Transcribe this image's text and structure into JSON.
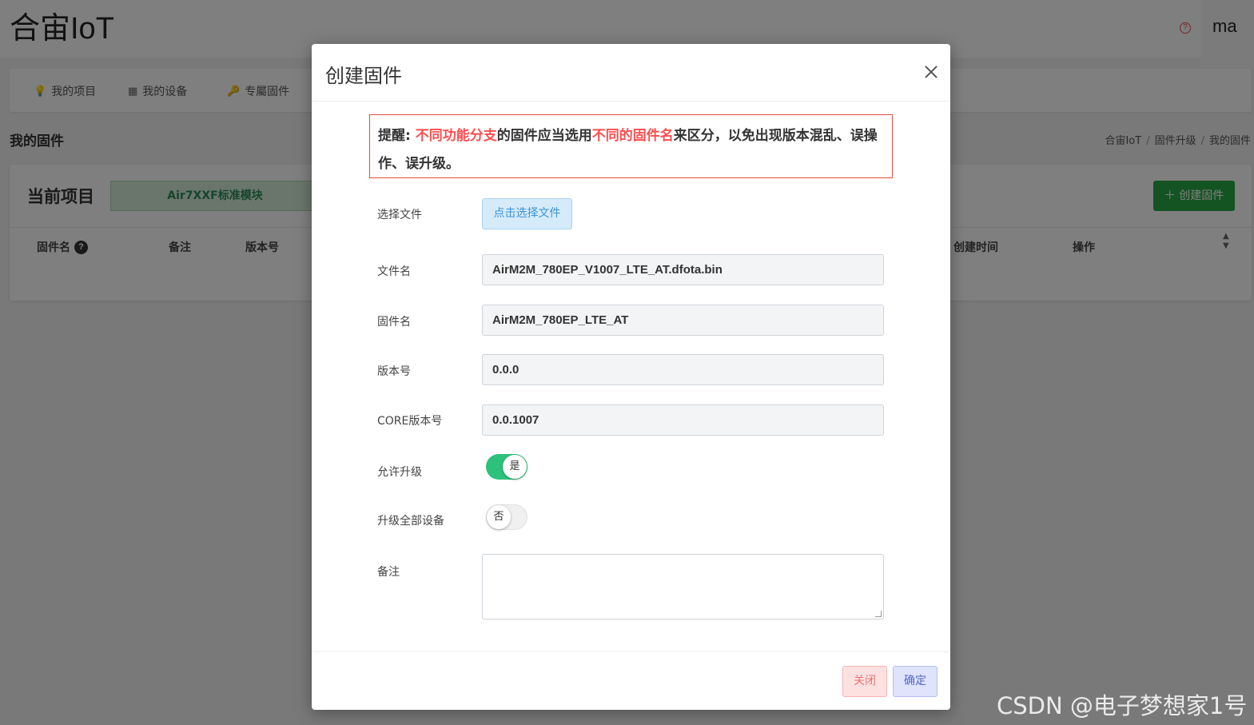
{
  "app": {
    "title": "合宙IoT",
    "help_icon": "?",
    "user": "ma"
  },
  "nav": {
    "items": [
      {
        "icon": "lightbulb-icon",
        "label": "我的项目"
      },
      {
        "icon": "chip-icon",
        "label": "我的设备"
      },
      {
        "icon": "key-icon",
        "label": "专屬固件"
      }
    ]
  },
  "page": {
    "heading": "我的固件",
    "breadcrumb": [
      "合宙IoT",
      "固件升级",
      "我的固件"
    ],
    "current_project_label": "当前项目",
    "current_project_value": "Air7XXF标准模块",
    "create_button": "＋ 创建固件",
    "table_headers": {
      "firmware_name": "固件名",
      "remark": "备注",
      "version": "版本号",
      "created_at": "创建时间",
      "actions": "操作"
    }
  },
  "modal": {
    "title": "创建固件",
    "warning": {
      "prefix": "提醒: ",
      "red1": "不同功能分支",
      "mid": "的固件应当选用",
      "red2": "不同的固件名",
      "suffix": "来区分，以免出现版本混乱、误操作、误升级。"
    },
    "fields": {
      "choose_file_label": "选择文件",
      "choose_file_button": "点击选择文件",
      "file_name_label": "文件名",
      "file_name_value": "AirM2M_780EP_V1007_LTE_AT.dfota.bin",
      "firmware_name_label": "固件名",
      "firmware_name_value": "AirM2M_780EP_LTE_AT",
      "version_label": "版本号",
      "version_value": "0.0.0",
      "core_version_label": "CORE版本号",
      "core_version_value": "0.0.1007",
      "allow_upgrade_label": "允许升级",
      "allow_upgrade_value": "是",
      "upgrade_all_label": "升级全部设备",
      "upgrade_all_value": "否",
      "remark_label": "备注",
      "remark_value": ""
    },
    "footer": {
      "close": "关闭",
      "ok": "确定"
    }
  },
  "watermark": "CSDN @电子梦想家1号",
  "colors": {
    "accent_green": "#28a745",
    "warning_red": "#ff4d4f",
    "toggle_on": "#2ec17c"
  }
}
